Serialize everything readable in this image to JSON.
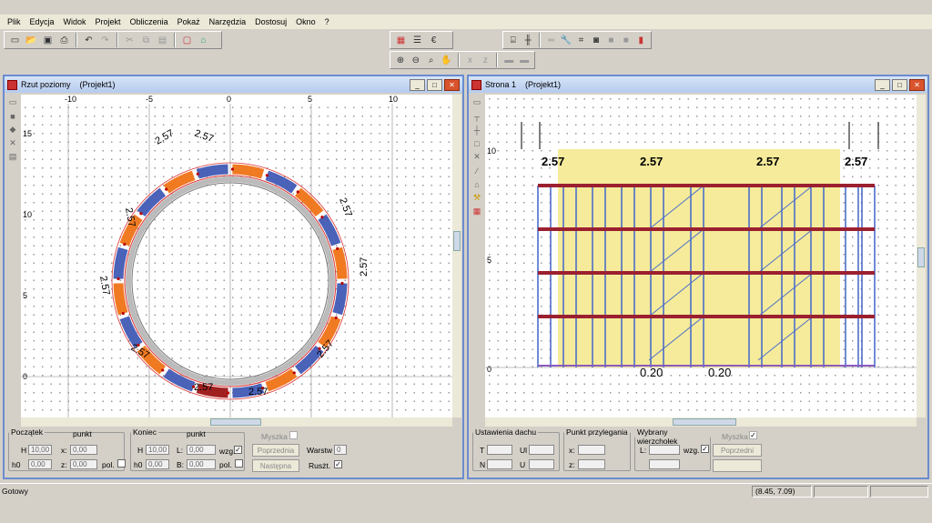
{
  "menu": [
    "Plik",
    "Edycja",
    "Widok",
    "Projekt",
    "Obliczenia",
    "Pokaż",
    "Narzędzia",
    "Dostosuj",
    "Okno",
    "?"
  ],
  "left_window": {
    "title": "Rzut poziomy",
    "project": "(Projekt1)",
    "ruler_top": [
      "-10",
      "-5",
      "0",
      "5",
      "10"
    ],
    "ruler_left": [
      "15",
      "10",
      "5",
      "0"
    ],
    "segment_label": "2.57"
  },
  "right_window": {
    "title": "Strona 1",
    "project": "(Projekt1)",
    "y_labels": [
      "10",
      "5",
      "0"
    ],
    "top_label": "2.57",
    "bottom_label": "0.20"
  },
  "left_panel": {
    "start_legend": "Początek",
    "start_point": "punkt",
    "H_label": "H",
    "H_value": "10,00",
    "x_label": "x:",
    "x_value": "0,00",
    "h0_label": "h0",
    "h0_value": "0,00",
    "z_label": "z:",
    "z_value": "0,00",
    "pol_label": "pol.",
    "end_legend": "Koniec",
    "end_point": "punkt",
    "end_H_label": "H",
    "end_H_value": "10,00",
    "L_label": "L:",
    "L_value": "0,00",
    "end_h0_label": "h0",
    "end_h0_value": "0,00",
    "B_label": "B:",
    "B_value": "0,00",
    "wzg_label": "wzg.",
    "end_pol_label": "pol.",
    "mouse_label": "Myszka",
    "prev_button": "Poprzednia",
    "next_button": "Następna",
    "layer_label": "Warstw",
    "layer_value": "0",
    "scaff_label": "Rusżt."
  },
  "right_panel": {
    "roof_legend": "Ustawienia dachu",
    "T_label": "T",
    "N_label": "N",
    "Ul_label": "Ul",
    "U_label": "U",
    "point_legend": "Punkt przylegania",
    "px_label": "x:",
    "pz_label": "z:",
    "peak_legend": "Wybrany wierzchołek",
    "L_label": "L:",
    "wzg_label": "wzg.",
    "mouse_label": "Myszka",
    "prev_button": "Poprzedni"
  },
  "status": {
    "text": "Gotowy",
    "coords": "(8.45, 7.09)"
  },
  "colors": {
    "orange": "#f07a22",
    "blue": "#4a62b8",
    "yellow": "#f5eb9a",
    "frame_blue": "#4d6ec8",
    "ledger_red": "#9b2030"
  }
}
